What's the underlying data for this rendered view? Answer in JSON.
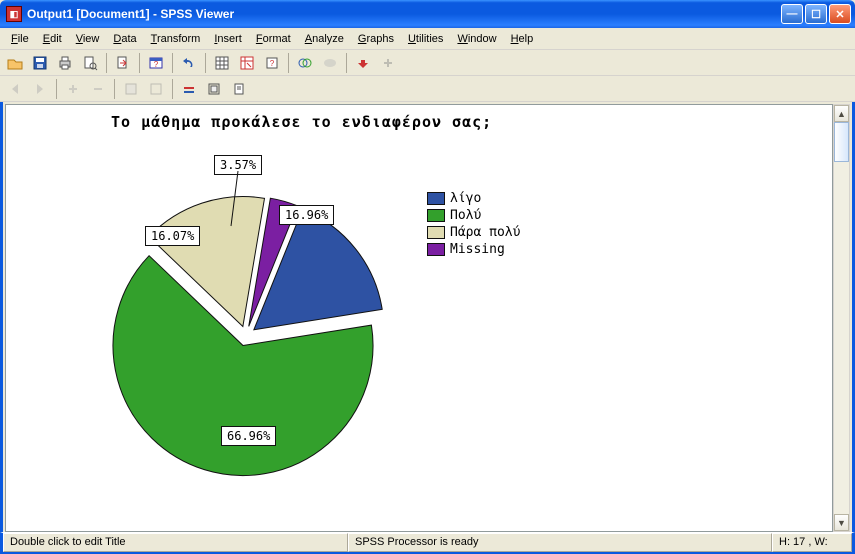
{
  "window": {
    "title": "Output1 [Document1] - SPSS Viewer"
  },
  "menu": {
    "file": "File",
    "edit": "Edit",
    "view": "View",
    "data": "Data",
    "transform": "Transform",
    "insert": "Insert",
    "format": "Format",
    "analyze": "Analyze",
    "graphs": "Graphs",
    "utilities": "Utilities",
    "window": "Window",
    "help": "Help"
  },
  "status": {
    "left": "Double click to edit Title",
    "center": "SPSS Processor is ready",
    "right": "H: 17 , W: "
  },
  "chart_data": {
    "type": "pie",
    "title": "Το μάθημα προκάλεσε το ενδιαφέρον σας;",
    "series": [
      {
        "name": "λίγο",
        "value": 16.96,
        "label": "16.96%",
        "color": "#2e52a3"
      },
      {
        "name": "Πολύ",
        "value": 66.96,
        "label": "66.96%",
        "color": "#33a02c"
      },
      {
        "name": "Πάρα πολύ",
        "value": 16.07,
        "label": "16.07%",
        "color": "#e0dcb2"
      },
      {
        "name": "Missing",
        "value": 3.57,
        "label": "3.57%",
        "color": "#7b1fa2"
      }
    ],
    "legend_position": "right"
  }
}
